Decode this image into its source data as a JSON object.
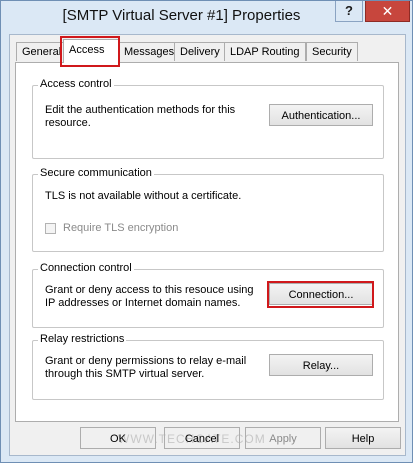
{
  "window": {
    "title": "[SMTP Virtual Server #1] Properties",
    "help_glyph": "?",
    "close_glyph": "✕"
  },
  "tabs": [
    {
      "label": "General",
      "active": false
    },
    {
      "label": "Access",
      "active": true
    },
    {
      "label": "Messages",
      "active": false
    },
    {
      "label": "Delivery",
      "active": false
    },
    {
      "label": "LDAP Routing",
      "active": false
    },
    {
      "label": "Security",
      "active": false
    }
  ],
  "groups": {
    "access_control": {
      "legend": "Access control",
      "line1": "Edit the authentication methods for this",
      "line2": "resource.",
      "button": "Authentication..."
    },
    "secure_communication": {
      "legend": "Secure communication",
      "text": "TLS is not available without a certificate.",
      "checkbox_label": "Require TLS encryption",
      "checkbox_checked": false,
      "checkbox_enabled": false
    },
    "connection_control": {
      "legend": "Connection control",
      "line1": "Grant or deny access to this resouce using",
      "line2": "IP addresses or Internet domain names.",
      "button": "Connection..."
    },
    "relay_restrictions": {
      "legend": "Relay restrictions",
      "line1": "Grant or deny permissions to relay e-mail",
      "line2": "through this SMTP virtual server.",
      "button": "Relay..."
    }
  },
  "footer": {
    "ok": "OK",
    "cancel": "Cancel",
    "apply": "Apply",
    "help": "Help"
  },
  "watermark": "WWW.TECHCATE.COM",
  "colors": {
    "highlight": "#d0181b",
    "close_button": "#c7463d",
    "frame": "#dbe8f5"
  },
  "icons": [
    "help-icon",
    "close-icon",
    "checkbox-icon"
  ]
}
